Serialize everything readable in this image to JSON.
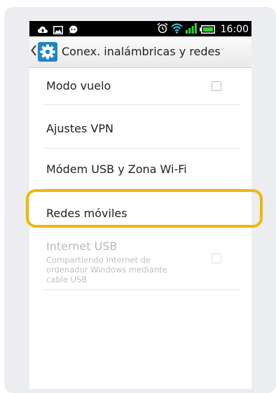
{
  "status_bar": {
    "time": "16:00",
    "left_icons": [
      "cloud-upload-icon",
      "image-icon",
      "chat-icon"
    ],
    "right_icons": [
      "alarm-icon",
      "wifi-icon",
      "signal-icon",
      "battery-icon"
    ]
  },
  "action_bar": {
    "title": "Conex. inalámbricas y redes",
    "icon": "gear-icon",
    "back_icon": "chevron-left-icon"
  },
  "settings": {
    "items": [
      {
        "label": "Modo vuelo",
        "has_checkbox": true,
        "checked": false
      },
      {
        "label": "Ajustes VPN"
      },
      {
        "label": "Módem USB y Zona Wi-Fi"
      },
      {
        "label": "Redes móviles",
        "highlighted": true
      },
      {
        "label": "Internet USB",
        "summary": "Compartiendo Internet de ordenador Windows mediante cable USB",
        "disabled": true,
        "has_checkbox": true,
        "checked": false
      }
    ]
  },
  "colors": {
    "highlight": "#f2b800",
    "accent": "#1e86c8",
    "signal": "#2fd12f"
  }
}
